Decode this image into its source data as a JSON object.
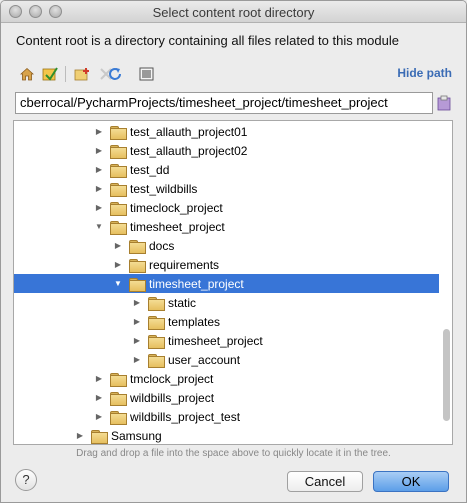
{
  "window": {
    "title": "Select content root directory"
  },
  "description": "Content root is a directory containing all files related to this module",
  "toolbar": {
    "icons": [
      "home-icon",
      "project-icon",
      "new-folder-icon",
      "refresh-icon",
      "show-hidden-icon"
    ],
    "hide_path_label": "Hide path"
  },
  "path_field": {
    "value": "cberrocal/PycharmProjects/timesheet_project/timesheet_project"
  },
  "tree": {
    "rows": [
      {
        "label": "test_allauth_project01",
        "depth": 1,
        "expanded": false,
        "selected": false
      },
      {
        "label": "test_allauth_project02",
        "depth": 1,
        "expanded": false,
        "selected": false
      },
      {
        "label": "test_dd",
        "depth": 1,
        "expanded": false,
        "selected": false
      },
      {
        "label": "test_wildbills",
        "depth": 1,
        "expanded": false,
        "selected": false
      },
      {
        "label": "timeclock_project",
        "depth": 1,
        "expanded": false,
        "selected": false
      },
      {
        "label": "timesheet_project",
        "depth": 1,
        "expanded": true,
        "selected": false
      },
      {
        "label": "docs",
        "depth": 2,
        "expanded": false,
        "selected": false
      },
      {
        "label": "requirements",
        "depth": 2,
        "expanded": false,
        "selected": false
      },
      {
        "label": "timesheet_project",
        "depth": 2,
        "expanded": true,
        "selected": true
      },
      {
        "label": "static",
        "depth": 3,
        "expanded": false,
        "selected": false
      },
      {
        "label": "templates",
        "depth": 3,
        "expanded": false,
        "selected": false
      },
      {
        "label": "timesheet_project",
        "depth": 3,
        "expanded": false,
        "selected": false
      },
      {
        "label": "user_account",
        "depth": 3,
        "expanded": false,
        "selected": false
      },
      {
        "label": "tmclock_project",
        "depth": 1,
        "expanded": false,
        "selected": false
      },
      {
        "label": "wildbills_project",
        "depth": 1,
        "expanded": false,
        "selected": false
      },
      {
        "label": "wildbills_project_test",
        "depth": 1,
        "expanded": false,
        "selected": false
      },
      {
        "label": "Samsung",
        "depth": 0,
        "expanded": false,
        "selected": false
      }
    ]
  },
  "hint": "Drag and drop a file into the space above to quickly locate it in the tree.",
  "buttons": {
    "help": "?",
    "cancel": "Cancel",
    "ok": "OK"
  }
}
